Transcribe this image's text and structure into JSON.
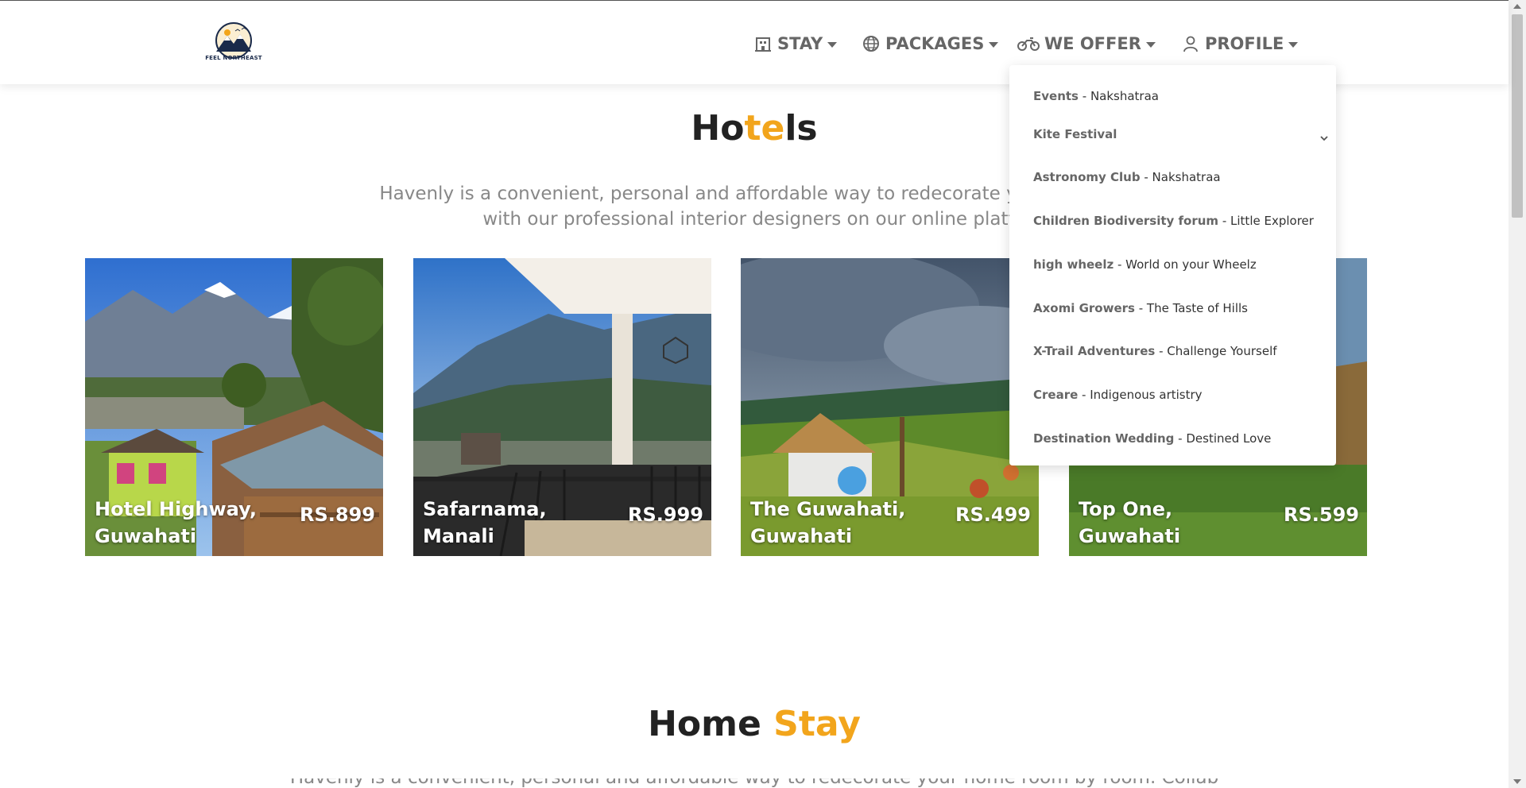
{
  "brand": {
    "logo_text": "FEEL NORTHEAST"
  },
  "nav": {
    "items": [
      {
        "label": "STAY",
        "icon": "hotel-icon"
      },
      {
        "label": "PACKAGES",
        "icon": "globe-icon"
      },
      {
        "label": "WE OFFER",
        "icon": "motorbike-icon"
      },
      {
        "label": "PROFILE",
        "icon": "user-icon"
      }
    ]
  },
  "dropdown": {
    "items": [
      {
        "name": "Events",
        "tag": "Nakshatraa"
      },
      {
        "name": "Kite Festival",
        "tag": ""
      },
      {
        "name": "Astronomy Club",
        "tag": "Nakshatraa"
      },
      {
        "name": "Children Biodiversity forum",
        "tag": "Little Explorer"
      },
      {
        "name": "high wheelz",
        "tag": "World on your Wheelz"
      },
      {
        "name": "Axomi Growers",
        "tag": "The Taste of Hills"
      },
      {
        "name": "X-Trail Adventures",
        "tag": "Challenge Yourself"
      },
      {
        "name": "Creare",
        "tag": "Indigenous artistry"
      },
      {
        "name": "Destination Wedding",
        "tag": "Destined Love"
      }
    ],
    "separator": " - "
  },
  "hotels": {
    "title_part1": "Ho",
    "title_accent": "te",
    "title_part2": "ls",
    "description_line1": "Havenly is a convenient, personal and affordable way to redecorate your home ro",
    "description_line2": "with our professional interior designers on our online platfo",
    "cards": [
      {
        "name_line1": "Hotel Highway,",
        "name_line2": "Guwahati",
        "price": "RS.899"
      },
      {
        "name_line1": "Safarnama,",
        "name_line2": "Manali",
        "price": "RS.999"
      },
      {
        "name_line1": "The Guwahati,",
        "name_line2": "Guwahati",
        "price": "RS.499"
      },
      {
        "name_line1": "Top One,",
        "name_line2": "Guwahati",
        "price": "RS.599"
      }
    ]
  },
  "homestay": {
    "title_part1": "Home ",
    "title_accent": "Stay",
    "description_partial": "Havenly is a convenient, personal and affordable way to redecorate your home room by room. Collab"
  },
  "colors": {
    "accent": "#f2a51c",
    "nav_text": "#666666"
  }
}
